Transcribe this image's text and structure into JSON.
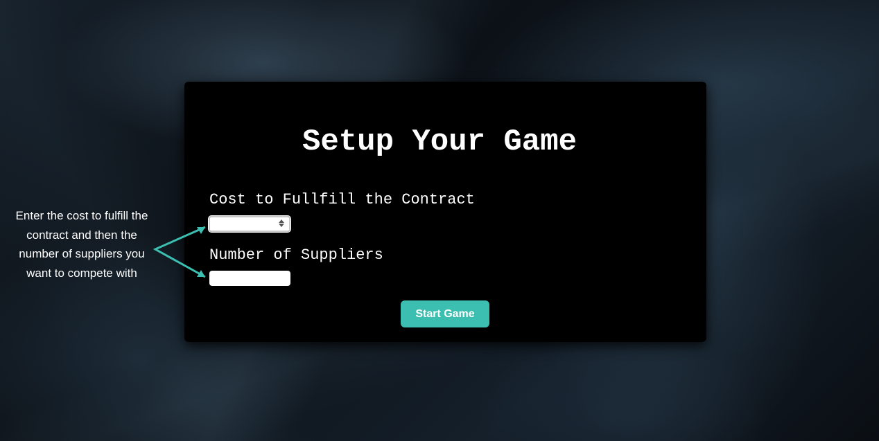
{
  "setup": {
    "title": "Setup Your Game",
    "cost_label": "Cost to Fullfill the Contract",
    "cost_value": "",
    "suppliers_label": "Number of Suppliers",
    "suppliers_value": "",
    "start_button": "Start Game"
  },
  "hint": {
    "text": "Enter the cost to fulfill the contract and then the number of suppliers you want to compete with"
  },
  "colors": {
    "accent": "#3cbfb0",
    "card_background": "#000000",
    "text": "#ffffff"
  },
  "icons": {
    "arrow": "double-arrow-icon",
    "spinner": "spinner-icon"
  }
}
